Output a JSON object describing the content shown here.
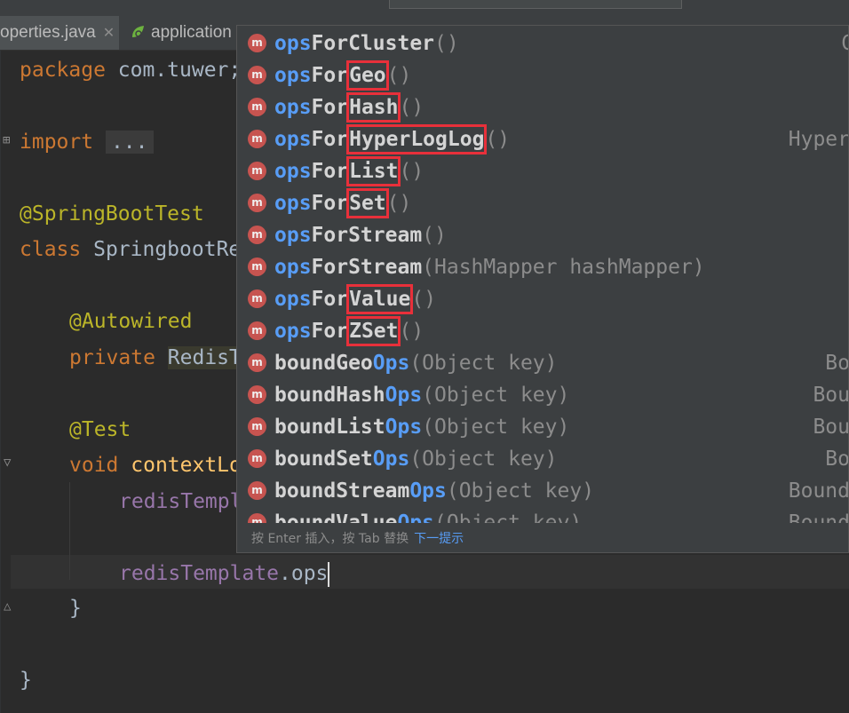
{
  "tabs": [
    {
      "label": "operties.java"
    },
    {
      "label": "application"
    }
  ],
  "editor": {
    "lines": {
      "package_kw": "package",
      "package_name": " com.tuwer;",
      "import_kw": "import",
      "import_fold": "...",
      "annotation_test_class": "@SpringBootTest",
      "class_kw": "class",
      "class_name": " SpringbootRe",
      "annotation_autowired": "@Autowired",
      "private_kw": "private",
      "type_partial": "RedisT",
      "annotation_test": "@Test",
      "void_kw": "void",
      "method_partial": "contextLo",
      "redis_line_partial": "redisTempl",
      "current_field": "redisTemplate",
      "current_suffix": ".ops",
      "close_brace_inner": "}",
      "close_brace_outer": "}"
    }
  },
  "completion": {
    "items": [
      {
        "pre": "ops",
        "mid": "ForCluster",
        "hl": "",
        "post": "",
        "args": "()",
        "type": "C"
      },
      {
        "pre": "ops",
        "mid": "For",
        "hl": "Geo",
        "post": "",
        "args": "()",
        "type": ""
      },
      {
        "pre": "ops",
        "mid": "For",
        "hl": "Hash",
        "post": "",
        "args": "()",
        "type": ""
      },
      {
        "pre": "ops",
        "mid": "For",
        "hl": "HyperLogLog",
        "post": "",
        "args": "()",
        "type": "Hyper"
      },
      {
        "pre": "ops",
        "mid": "For",
        "hl": "List",
        "post": "",
        "args": "()",
        "type": ""
      },
      {
        "pre": "ops",
        "mid": "For",
        "hl": "Set",
        "post": "",
        "args": "()",
        "type": ""
      },
      {
        "pre": "ops",
        "mid": "ForStream",
        "hl": "",
        "post": "",
        "args": "()",
        "type": ""
      },
      {
        "pre": "ops",
        "mid": "ForStream",
        "hl": "",
        "post": "",
        "args": "(HashMapper hashMapper)",
        "type": ""
      },
      {
        "pre": "ops",
        "mid": "For",
        "hl": "Value",
        "post": "",
        "args": "()",
        "type": ""
      },
      {
        "pre": "ops",
        "mid": "For",
        "hl": "ZSet",
        "post": "",
        "args": "()",
        "type": ""
      },
      {
        "lead": "boundGeo",
        "tail": "Ops",
        "args": "(Object key)",
        "type": "Bo"
      },
      {
        "lead": "boundHash",
        "tail": "Ops",
        "args": "(Object key)",
        "type": "Bou"
      },
      {
        "lead": "boundList",
        "tail": "Ops",
        "args": "(Object key)",
        "type": "Bou"
      },
      {
        "lead": "boundSet",
        "tail": "Ops",
        "args": "(Object key)",
        "type": "Bo"
      },
      {
        "lead": "boundStream",
        "tail": "Ops",
        "args": "(Object key)",
        "type": "Bound"
      },
      {
        "lead": "boundValue",
        "tail": "Ops",
        "args": "(Object key)",
        "type": "Bound"
      }
    ],
    "footer": {
      "hint": "按 Enter 插入，按 Tab 替换",
      "link": "下一提示"
    }
  },
  "colors": {
    "editor_bg": "#2b2b2b",
    "popup_bg": "#3c3f41",
    "match_blue": "#589df6",
    "highlight_red": "#e8303a",
    "method_badge": "#c75450"
  }
}
